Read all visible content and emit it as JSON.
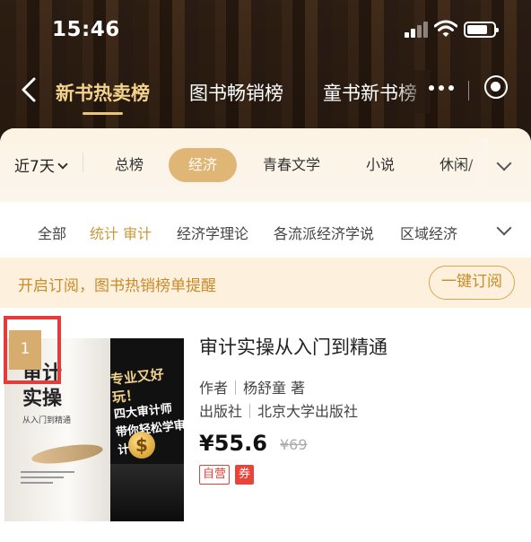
{
  "status_bar": {
    "time": "15:46"
  },
  "nav": {
    "tabs": [
      "新书热卖榜",
      "图书畅销榜",
      "童书新书榜"
    ],
    "active_tab_index": 0
  },
  "filters": {
    "period": "近7天",
    "categories": [
      "总榜",
      "经济",
      "青春文学",
      "小说",
      "休闲/"
    ],
    "active_category": "经济",
    "subcategories": [
      "全部",
      "统计 审计",
      "经济学理论",
      "各流派经济学说",
      "区域经济"
    ],
    "active_subcategory": "统计 审计"
  },
  "subscribe": {
    "text": "开启订阅，图书热销榜单提醒",
    "button": "一键订阅"
  },
  "book": {
    "rank": "1",
    "title": "审计实操从入门到精通",
    "author_label": "作者",
    "author": "杨舒童 著",
    "publisher_label": "出版社",
    "publisher": "北京大学出版社",
    "price": "¥55.6",
    "original_price": "¥69",
    "tag_self": "自营",
    "tag_coupon": "券",
    "cover": {
      "title_line1": "审计",
      "title_line2": "实操",
      "subtitle": "从入门到精通",
      "slogan1": "专业又好玩！",
      "slogan2": "四大审计师",
      "slogan3": "带你轻松学审计",
      "dollar": "$"
    }
  },
  "colors": {
    "accent_gold": "#dfb676",
    "subscribe_text": "#c98a2a",
    "highlight_red": "#e23c3c"
  }
}
